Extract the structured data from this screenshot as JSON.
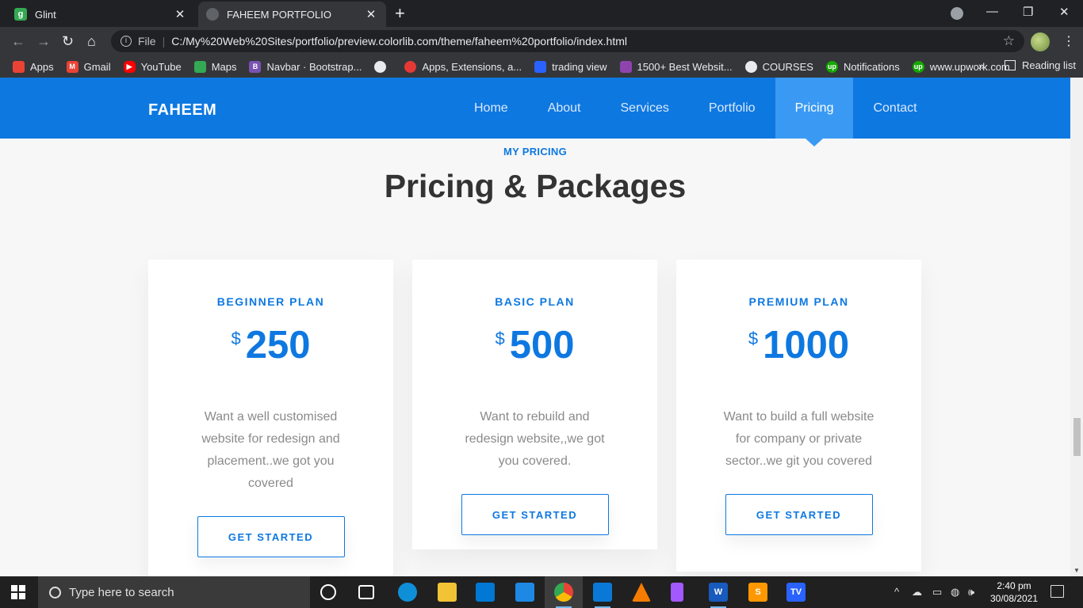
{
  "browser": {
    "tabs": [
      {
        "title": "Glint",
        "favicon": "g",
        "favicon_color": "#34a853",
        "active": false
      },
      {
        "title": "FAHEEM PORTFOLIO",
        "favicon": "",
        "favicon_color": "#5f6368",
        "active": true
      }
    ],
    "address": {
      "scheme_label": "File",
      "url": "C:/My%20Web%20Sites/portfolio/preview.colorlib.com/theme/faheem%20portfolio/index.html"
    },
    "bookmarks": [
      {
        "label": "Apps",
        "icon": "apps-grid-icon",
        "color": "#ea4335"
      },
      {
        "label": "Gmail",
        "icon": "gmail-icon",
        "color": "#ea4335"
      },
      {
        "label": "YouTube",
        "icon": "youtube-icon",
        "color": "#ff0000"
      },
      {
        "label": "Maps",
        "icon": "maps-icon",
        "color": "#34a853"
      },
      {
        "label": "Navbar · Bootstrap...",
        "icon": "bootstrap-icon",
        "color": "#7952b3"
      },
      {
        "label": "",
        "icon": "globe-icon",
        "color": "#e8eaed"
      },
      {
        "label": "Apps, Extensions, a...",
        "icon": "extension-icon",
        "color": "#e53935"
      },
      {
        "label": "trading view",
        "icon": "tradingview-icon",
        "color": "#2962ff"
      },
      {
        "label": "1500+ Best Websit...",
        "icon": "colorlib-icon",
        "color": "#8e44ad"
      },
      {
        "label": "COURSES",
        "icon": "globe-icon",
        "color": "#e8eaed"
      },
      {
        "label": "Notifications",
        "icon": "upwork-icon",
        "color": "#14a800"
      },
      {
        "label": "www.upwork.com",
        "icon": "upwork-icon",
        "color": "#14a800"
      }
    ],
    "bookmarks_more": "»",
    "reading_list": "Reading list"
  },
  "site": {
    "logo": "FAHEEM",
    "nav": [
      "Home",
      "About",
      "Services",
      "Portfolio",
      "Pricing",
      "Contact"
    ],
    "active_nav": "Pricing",
    "accent": "#0e78e1"
  },
  "pricing": {
    "eyebrow": "MY PRICING",
    "title": "Pricing & Packages",
    "plans": [
      {
        "name": "BEGINNER PLAN",
        "currency": "$",
        "amount": "250",
        "description": "Want a well customised website for redesign and placement..we got you covered",
        "cta": "GET STARTED"
      },
      {
        "name": "BASIC PLAN",
        "currency": "$",
        "amount": "500",
        "description": "Want to rebuild and redesign website,,we got you covered.",
        "cta": "GET STARTED"
      },
      {
        "name": "PREMIUM PLAN",
        "currency": "$",
        "amount": "1000",
        "description": "Want to build a full website for company or private sector..we git you covered",
        "cta": "GET STARTED"
      }
    ]
  },
  "taskbar": {
    "search_placeholder": "Type here to search",
    "time": "2:40 pm",
    "date": "30/08/2021"
  }
}
